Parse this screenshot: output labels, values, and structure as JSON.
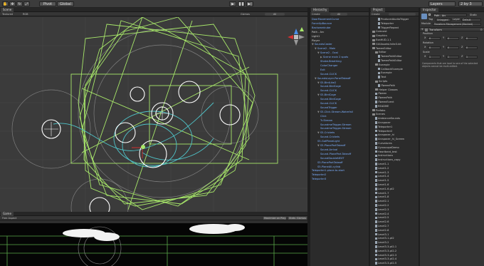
{
  "toolbar": {
    "pivot_label": "Pivot",
    "global_label": "Global",
    "play_icon": "play-icon",
    "pause_icon": "pause-icon",
    "step_icon": "step-icon",
    "layers_label": "Layers",
    "layout_label": "2 by 3"
  },
  "scene": {
    "tab_label": "Scene",
    "shading_label": "Textured",
    "mode_label": "RGB",
    "gizmos_label": "Gizmos",
    "search_label": "All"
  },
  "game": {
    "tab_label": "Game",
    "aspect_label": "Free Aspect",
    "maximize_label": "Maximize on Play",
    "stats_label": "Stats",
    "gizmos_label": "Gizmos"
  },
  "hierarchy": {
    "tab_label": "Hierarchy",
    "create_label": "Create",
    "search_label": "All",
    "items": [
      {
        "label": "DoorMovementCurve",
        "depth": 0,
        "blue": true,
        "fold": ""
      },
      {
        "label": "ForceUpBounce",
        "depth": 0,
        "blue": true,
        "fold": ""
      },
      {
        "label": "Backwardcube",
        "depth": 0,
        "blue": true,
        "fold": ""
      },
      {
        "label": "Path - Arc",
        "depth": 0,
        "blue": false,
        "fold": ""
      },
      {
        "label": "Light1",
        "depth": 0,
        "blue": false,
        "fold": ""
      },
      {
        "label": "Player",
        "depth": 0,
        "blue": false,
        "fold": ""
      },
      {
        "label": "SoundsCaster",
        "depth": 0,
        "blue": true,
        "fold": "▼"
      },
      {
        "label": "Scene2 - Main",
        "depth": 1,
        "blue": true,
        "fold": "▼"
      },
      {
        "label": "Scene2 - Oval",
        "depth": 2,
        "blue": true,
        "fold": "▼"
      },
      {
        "label": "Scene main 2 spots",
        "depth": 3,
        "blue": true,
        "fold": "▶"
      },
      {
        "label": "Shake-Breathing",
        "depth": 3,
        "blue": true,
        "fold": ""
      },
      {
        "label": "ColorChanger",
        "depth": 3,
        "blue": true,
        "fold": ""
      },
      {
        "label": "Exit",
        "depth": 3,
        "blue": true,
        "fold": ""
      },
      {
        "label": "Sound-CLICK",
        "depth": 3,
        "blue": true,
        "fold": ""
      },
      {
        "label": "SoundsLayer-PanelTakeoff",
        "depth": 1,
        "blue": true,
        "fold": "▼"
      },
      {
        "label": "S5-BirdLike2",
        "depth": 2,
        "blue": true,
        "fold": "▼"
      },
      {
        "label": "Sound-BirdCage",
        "depth": 3,
        "blue": true,
        "fold": ""
      },
      {
        "label": "Sound-CLICK",
        "depth": 3,
        "blue": true,
        "fold": ""
      },
      {
        "label": "S5-BirdCage",
        "depth": 2,
        "blue": true,
        "fold": "▼"
      },
      {
        "label": "Sound-BirdCage",
        "depth": 3,
        "blue": true,
        "fold": ""
      },
      {
        "label": "Sound-CLICK",
        "depth": 3,
        "blue": true,
        "fold": ""
      },
      {
        "label": "SoundTrigger",
        "depth": 3,
        "blue": true,
        "fold": ""
      },
      {
        "label": "S5-Click-Stream-Waterfall",
        "depth": 2,
        "blue": true,
        "fold": "▼"
      },
      {
        "label": "Click",
        "depth": 3,
        "blue": true,
        "fold": ""
      },
      {
        "label": "Tr-Stream",
        "depth": 3,
        "blue": true,
        "fold": ""
      },
      {
        "label": "SoundmeTrigger-Stream",
        "depth": 3,
        "blue": true,
        "fold": ""
      },
      {
        "label": "SoundmeTrigger-Stream",
        "depth": 3,
        "blue": true,
        "fold": ""
      },
      {
        "label": "S5-Crickets",
        "depth": 2,
        "blue": true,
        "fold": "▼"
      },
      {
        "label": "Sound-Crickets",
        "depth": 3,
        "blue": true,
        "fold": ""
      },
      {
        "label": "S5-GotPlaneLight",
        "depth": 2,
        "blue": true,
        "fold": ""
      },
      {
        "label": "S5-PlanePartTakeoff",
        "depth": 2,
        "blue": true,
        "fold": "▼"
      },
      {
        "label": "Sound-Arrival",
        "depth": 3,
        "blue": true,
        "fold": ""
      },
      {
        "label": "Sound-PlanePart-Takeoff",
        "depth": 3,
        "blue": true,
        "fold": ""
      },
      {
        "label": "SoundDoubleNEXT",
        "depth": 3,
        "blue": true,
        "fold": ""
      },
      {
        "label": "S5-PlanePartTakeoff",
        "depth": 2,
        "blue": true,
        "fold": ""
      },
      {
        "label": "S5-PlaneAll-cylinb",
        "depth": 2,
        "blue": true,
        "fold": ""
      },
      {
        "label": "Teleporter1-place-to-start",
        "depth": 0,
        "blue": true,
        "fold": ""
      },
      {
        "label": "Teleporter2",
        "depth": 0,
        "blue": true,
        "fold": ""
      },
      {
        "label": "Teleporter3",
        "depth": 0,
        "blue": true,
        "fold": ""
      }
    ]
  },
  "project": {
    "tab_label": "Project",
    "create_label": "Create",
    "items": [
      {
        "label": "ProducedAudioTrigger",
        "depth": 2,
        "kind": "file"
      },
      {
        "label": "Teleporter",
        "depth": 2,
        "kind": "file"
      },
      {
        "label": "TriggerRepeat",
        "depth": 2,
        "kind": "file"
      },
      {
        "label": "Comcast",
        "depth": 0,
        "kind": "folder"
      },
      {
        "label": "Graphics",
        "depth": 0,
        "kind": "folder"
      },
      {
        "label": "ExaHUD-1.1",
        "depth": 0,
        "kind": "folder"
      },
      {
        "label": "GUIAssetsUnite3.kit",
        "depth": 0,
        "kind": "folder"
      },
      {
        "label": "TweenEditor",
        "depth": 0,
        "kind": "folder"
      },
      {
        "label": "Editor",
        "depth": 1,
        "kind": "folder"
      },
      {
        "label": "TweenPathEditor",
        "depth": 2,
        "kind": "file"
      },
      {
        "label": "TweenPathEditor",
        "depth": 2,
        "kind": "file"
      },
      {
        "label": "Example",
        "depth": 1,
        "kind": "folder"
      },
      {
        "label": "CallbackExample",
        "depth": 2,
        "kind": "file"
      },
      {
        "label": "Example",
        "depth": 2,
        "kind": "file"
      },
      {
        "label": "Text",
        "depth": 2,
        "kind": "file"
      },
      {
        "label": "Scripts",
        "depth": 1,
        "kind": "folder"
      },
      {
        "label": "iTweenPath",
        "depth": 2,
        "kind": "file"
      },
      {
        "label": "Helper Classes",
        "depth": 1,
        "kind": "folder"
      },
      {
        "label": "iTween",
        "depth": 1,
        "kind": "file"
      },
      {
        "label": "iTweenPath",
        "depth": 1,
        "kind": "file"
      },
      {
        "label": "iTweenEvent",
        "depth": 1,
        "kind": "file"
      },
      {
        "label": "README",
        "depth": 1,
        "kind": "file"
      },
      {
        "label": "Prefabs",
        "depth": 0,
        "kind": "folder"
      },
      {
        "label": "Scenes",
        "depth": 0,
        "kind": "folder"
      },
      {
        "label": "AmbianceSounds",
        "depth": 1,
        "kind": "file"
      },
      {
        "label": "Arcspacer",
        "depth": 1,
        "kind": "file"
      },
      {
        "label": "Teleporter1",
        "depth": 1,
        "kind": "file"
      },
      {
        "label": "Teleporter2",
        "depth": 1,
        "kind": "file"
      },
      {
        "label": "Arcspacer_hi",
        "depth": 1,
        "kind": "file"
      },
      {
        "label": "Arcspacer_hi_Screen",
        "depth": 1,
        "kind": "file"
      },
      {
        "label": "Curvatures",
        "depth": 1,
        "kind": "file"
      },
      {
        "label": "GyroscopeDemo",
        "depth": 1,
        "kind": "file"
      },
      {
        "label": "Heartbeat_test",
        "depth": 1,
        "kind": "file"
      },
      {
        "label": "Instructions",
        "depth": 1,
        "kind": "file"
      },
      {
        "label": "Instructions_copy",
        "depth": 1,
        "kind": "file"
      },
      {
        "label": "Level1-1",
        "depth": 1,
        "kind": "file"
      },
      {
        "label": "Level1-2",
        "depth": 1,
        "kind": "file"
      },
      {
        "label": "Level1-3",
        "depth": 1,
        "kind": "file"
      },
      {
        "label": "Level1-4",
        "depth": 1,
        "kind": "file"
      },
      {
        "label": "Level1-5",
        "depth": 1,
        "kind": "file"
      },
      {
        "label": "Level1-6",
        "depth": 1,
        "kind": "file"
      },
      {
        "label": "Level1-6-pt2",
        "depth": 1,
        "kind": "file"
      },
      {
        "label": "Level1-7",
        "depth": 1,
        "kind": "file"
      },
      {
        "label": "Level1-8",
        "depth": 1,
        "kind": "file"
      },
      {
        "label": "Level2-1",
        "depth": 1,
        "kind": "file"
      },
      {
        "label": "Level2-2",
        "depth": 1,
        "kind": "file"
      },
      {
        "label": "Level2-3",
        "depth": 1,
        "kind": "file"
      },
      {
        "label": "Level2-4",
        "depth": 1,
        "kind": "file"
      },
      {
        "label": "Level2-5",
        "depth": 1,
        "kind": "file"
      },
      {
        "label": "Level2-6",
        "depth": 1,
        "kind": "file"
      },
      {
        "label": "Level2-7",
        "depth": 1,
        "kind": "file"
      },
      {
        "label": "Level2-8",
        "depth": 1,
        "kind": "file"
      },
      {
        "label": "Level3-1",
        "depth": 1,
        "kind": "file"
      },
      {
        "label": "Level3-1-pt2",
        "depth": 1,
        "kind": "file"
      },
      {
        "label": "Level3-2",
        "depth": 1,
        "kind": "file"
      },
      {
        "label": "Level3-3-pt2-1",
        "depth": 1,
        "kind": "file"
      },
      {
        "label": "Level3-3-pt2-2",
        "depth": 1,
        "kind": "file"
      },
      {
        "label": "Level3-3-pt2-3",
        "depth": 1,
        "kind": "file"
      },
      {
        "label": "Level3-3-pt2-4",
        "depth": 1,
        "kind": "file"
      },
      {
        "label": "Level3-3-pt2-5",
        "depth": 1,
        "kind": "file"
      },
      {
        "label": "Level3-4",
        "depth": 1,
        "kind": "file"
      }
    ]
  },
  "inspector": {
    "tab_label": "Inspector",
    "object_name": "Path - Arc",
    "static_label": "Static",
    "tag_label": "Tag",
    "tag_value": "Untagged",
    "layer_label": "Layer",
    "layer_value": "Default",
    "module_label": "Module",
    "module_value": "Transform Management (Stacked)",
    "transform_label": "Transform",
    "position_label": "Position",
    "rotation_label": "Rotation",
    "scale_label": "Scale",
    "x_label": "X",
    "y_label": "Y",
    "z_label": "Z",
    "position": {
      "x": "0",
      "y": "0",
      "z": "0"
    },
    "rotation": {
      "x": "0",
      "y": "0",
      "z": "0"
    },
    "scale": {
      "x": "1",
      "y": "1",
      "z": "1"
    },
    "note": "Components that are local to one of the selected objects cannot be multi-edited."
  },
  "colors": {
    "editor_bg": "#3b3b3b",
    "panel_bg": "#2f2f2f",
    "selection": "#3d5b84",
    "link_blue": "#7db0ff",
    "gizmo_green": "#a8e86a",
    "gizmo_cyan": "#4fc3c8",
    "gizmo_white": "#ffffff",
    "gizmo_red": "#d23030"
  }
}
